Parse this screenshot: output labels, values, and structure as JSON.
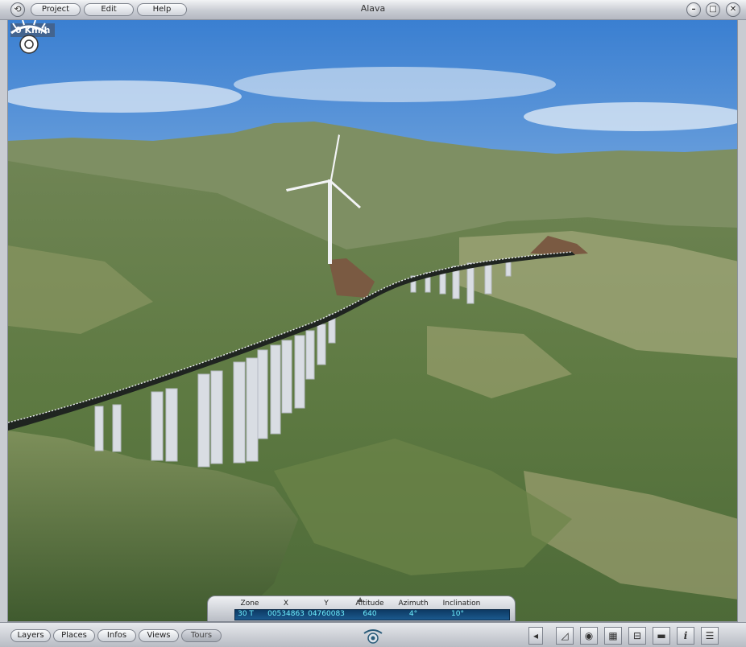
{
  "window": {
    "title": "Alava"
  },
  "menu": {
    "project": "Project",
    "edit": "Edit",
    "help": "Help"
  },
  "window_controls": {
    "minimize": "–",
    "maximize": "□",
    "close": "✕"
  },
  "viewport": {
    "speed": "0 Km/h"
  },
  "coords": {
    "headers": {
      "zone": "Zone",
      "x": "X",
      "y": "Y",
      "altitude": "Altitude",
      "azimuth": "Azimuth",
      "inclination": "Inclination"
    },
    "values": {
      "zone": "30 T",
      "x": "00534863",
      "y": "04760083",
      "altitude": "640",
      "azimuth": "4°",
      "inclination": "10°"
    }
  },
  "bottom_tabs": {
    "layers": "Layers",
    "places": "Places",
    "infos": "Infos",
    "views": "Views",
    "tours": "Tours"
  },
  "icons": {
    "app": "app-menu-icon",
    "eye": "eye-logo-icon",
    "collapse": "collapse-left-icon",
    "measure": "measure-icon",
    "camera": "camera-icon",
    "map": "map-icon",
    "tag": "tag-icon",
    "film": "clapperboard-icon",
    "info": "info-icon",
    "list": "list-icon"
  },
  "colors": {
    "coords_value": "#6ff0ff",
    "coords_bg": "#0d3a63"
  }
}
